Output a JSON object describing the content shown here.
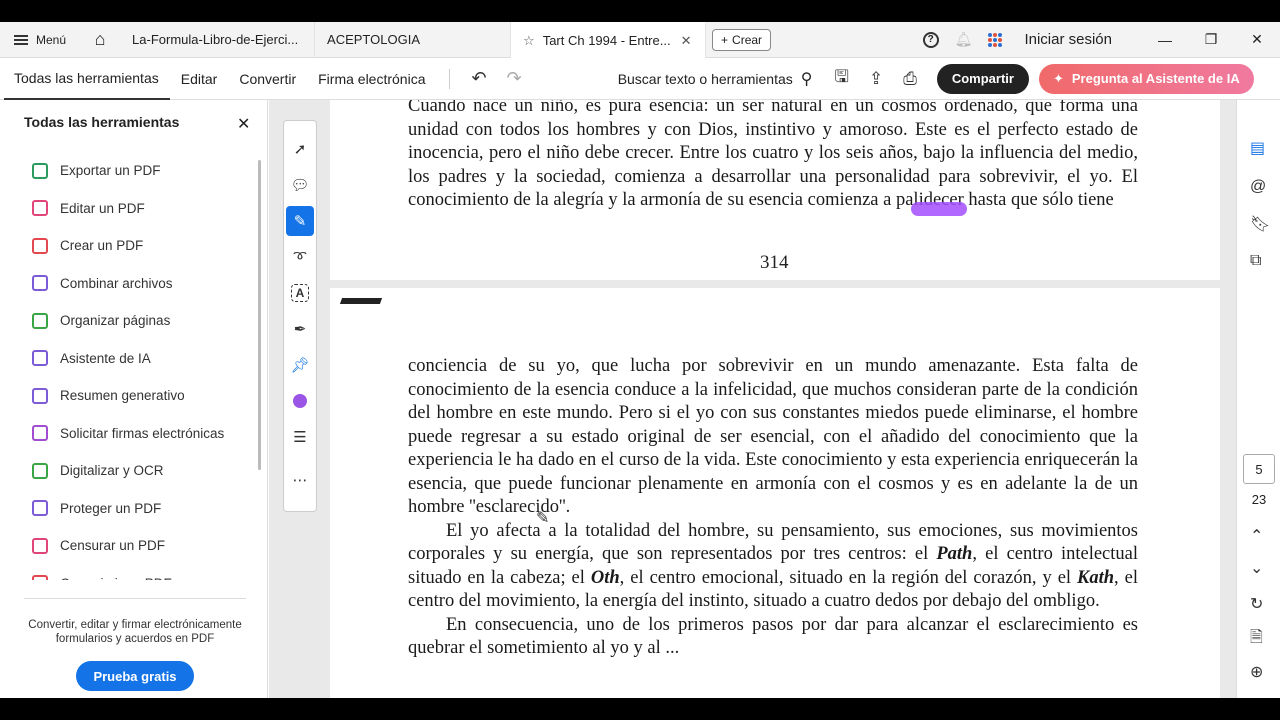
{
  "titlebar": {
    "menu_label": "Menú",
    "tabs": [
      {
        "label": "La-Formula-Libro-de-Ejerci..."
      },
      {
        "label": "ACEPTOLOGIA"
      },
      {
        "label": "Tart Ch 1994 - Entre..."
      }
    ],
    "create_label": "Crear",
    "signin_label": "Iniciar sesión"
  },
  "toolbar": {
    "tabs": [
      "Todas las herramientas",
      "Editar",
      "Convertir",
      "Firma electrónica"
    ],
    "search_label": "Buscar texto o herramientas",
    "share_label": "Compartir",
    "ai_label": "Pregunta al Asistente de IA"
  },
  "leftpanel": {
    "title": "Todas las herramientas",
    "items": [
      {
        "label": "Exportar un PDF",
        "color": "#2e9a5e"
      },
      {
        "label": "Editar un PDF",
        "color": "#e0457b"
      },
      {
        "label": "Crear un PDF",
        "color": "#e34850"
      },
      {
        "label": "Combinar archivos",
        "color": "#7c5cd6"
      },
      {
        "label": "Organizar páginas",
        "color": "#3aa545"
      },
      {
        "label": "Asistente de IA",
        "color": "#7c5cd6"
      },
      {
        "label": "Resumen generativo",
        "color": "#7c5cd6"
      },
      {
        "label": "Solicitar firmas electrónicas",
        "color": "#a24dcf"
      },
      {
        "label": "Digitalizar y OCR",
        "color": "#3aa545"
      },
      {
        "label": "Proteger un PDF",
        "color": "#7c5cd6"
      },
      {
        "label": "Censurar un PDF",
        "color": "#e0457b"
      },
      {
        "label": "Comprimir un PDF",
        "color": "#e34850"
      }
    ],
    "promo_text": "Convertir, editar y firmar electrónicamente formularios y acuerdos en PDF",
    "trial_label": "Prueba gratis"
  },
  "document": {
    "page1_lines": "Cuando nace un niño, es pura esencia: un ser natural en un cosmos ordenado, que forma una unidad con todos los hombres y con Dios, instintivo y amoroso. Este es el perfecto estado de inocencia, pero el niño debe crecer. Entre los cuatro y los seis años, bajo la influencia del medio, los padres y la sociedad, comienza a desarrollar una personalidad para sobrevivir, el yo. El conocimiento de la alegría y la armonía de su esencia comienza a palidecer hasta que sólo tiene",
    "page_number": "314",
    "para1": "conciencia de su yo, que lucha por sobrevivir en un mundo amenazante. Esta falta de conocimiento de la esencia conduce a la infelicidad, que muchos consideran parte de la condición del hombre en este mundo. Pero si el yo con sus constantes miedos puede eliminarse, el hombre puede regresar a su estado original de ser esencial, con el añadido del conocimiento que la experiencia le ha dado en el curso de la vida. Este conocimiento y esta experiencia enriquecerán la esencia, que puede funcionar plenamente en armonía con el cosmos y es en adelante la de un hombre ''esclarecido''.",
    "para2_a": "El yo afecta a la totalidad del hombre, su pensamiento, sus emociones, sus movimientos corporales y su energía, que son representados por tres centros: el ",
    "para2_path": "Path",
    "para2_b": ", el centro intelectual situado en la cabeza; el ",
    "para2_oth": "Oth",
    "para2_c": ", el centro emocional, situado en la región del corazón, y el ",
    "para2_kath": "Kath",
    "para2_d": ", el centro del movimiento, la energía del instinto, situado a cuatro dedos por debajo del ombligo.",
    "para3": "En consecuencia, uno de los primeros pasos por dar para alcanzar el esclarecimiento es quebrar el sometimiento al yo y al ..."
  },
  "pagination": {
    "current": "5",
    "total": "23"
  }
}
